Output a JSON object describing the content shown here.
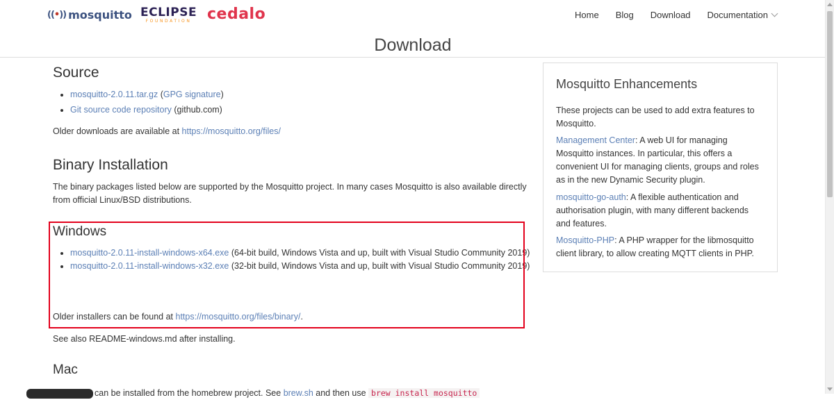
{
  "header": {
    "logo_mosquitto": "mosquitto",
    "logo_eclipse_main": "ECLIPSE",
    "logo_eclipse_sub": "FOUNDATION",
    "logo_cedalo": "cedalo",
    "nav": {
      "home": "Home",
      "blog": "Blog",
      "download": "Download",
      "documentation": "Documentation"
    }
  },
  "page_title": "Download",
  "source": {
    "heading": "Source",
    "items": [
      {
        "link": "mosquitto-2.0.11.tar.gz",
        "paren_open": " (",
        "sublink": "GPG signature",
        "paren_close": ")"
      },
      {
        "link": "Git source code repository",
        "suffix": " (github.com)"
      }
    ],
    "older_text": "Older downloads are available at ",
    "older_link": "https://mosquitto.org/files/"
  },
  "binary": {
    "heading": "Binary Installation",
    "description": "The binary packages listed below are supported by the Mosquitto project. In many cases Mosquitto is also available directly from official Linux/BSD distributions."
  },
  "windows": {
    "heading": "Windows",
    "items": [
      {
        "link": "mosquitto-2.0.11-install-windows-x64.exe",
        "desc": " (64-bit build, Windows Vista and up, built with Visual Studio Community 2019)"
      },
      {
        "link": "mosquitto-2.0.11-install-windows-x32.exe",
        "desc": " (32-bit build, Windows Vista and up, built with Visual Studio Community 2019)"
      }
    ],
    "older_text": "Older installers can be found at ",
    "older_link": "https://mosquitto.org/files/binary/",
    "older_end": ".",
    "see_also": "See also README-windows.md after installing.",
    "highlight_color": "#e3001b"
  },
  "mac": {
    "heading": "Mac",
    "partial_text": "can be installed from the homebrew project. See ",
    "partial_link": "brew.sh",
    "partial_mid": " and then use ",
    "partial_code": "brew install mosquitto"
  },
  "sidebar": {
    "title": "Mosquitto Enhancements",
    "intro": "These projects can be used to add extra features to Mosquitto.",
    "items": [
      {
        "link": "Management Center",
        "text": ": A web UI for managing Mosquitto instances. In particular, this offers a convenient UI for managing clients, groups and roles as in the new Dynamic Security plugin."
      },
      {
        "link": "mosquitto-go-auth",
        "text": ": A flexible authentication and authorisation plugin, with many different backends and features."
      },
      {
        "link": "Mosquitto-PHP",
        "text": ": A PHP wrapper for the libmosquitto client library, to allow creating MQTT clients in PHP."
      }
    ]
  },
  "colors": {
    "link": "#5b7fb5",
    "text": "#333333",
    "cedalo": "#e0344c"
  }
}
